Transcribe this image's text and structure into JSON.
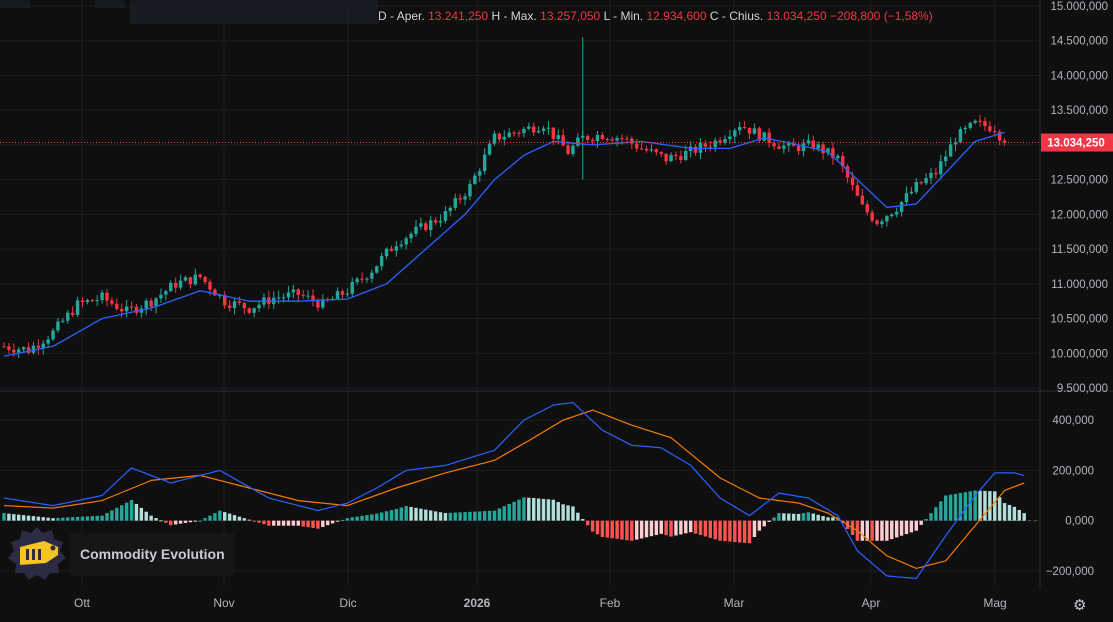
{
  "ohlc_header": {
    "prefix": "D",
    "open_label": "Aper.",
    "open_value": "13.241,250",
    "high_label": "H - Max.",
    "high_value": "13.257,050",
    "low_label": "L - Min.",
    "low_value": "12.934,600",
    "close_label": "C - Chius.",
    "close_value": "13.034,250",
    "change": "−208,800 (−1,58%)"
  },
  "brand": {
    "name": "Commodity Evolution"
  },
  "last_price_label": "13.034,250",
  "colors": {
    "up": "#26a69a",
    "down": "#f23645",
    "ma": "#2962ff",
    "macd": "#2962ff",
    "signal": "#f57c00",
    "hist_up_strong": "#26a69a",
    "hist_up_weak": "#b2dfdb",
    "hist_down_strong": "#ff5252",
    "hist_down_weak": "#ffcdd2",
    "background": "#0f0f0f"
  },
  "chart_data": [
    {
      "type": "candlestick",
      "x_labels": [
        "Ott",
        "Nov",
        "Dic",
        "2026",
        "Feb",
        "Mar",
        "Apr",
        "Mag"
      ],
      "y_ticks": [
        "15.000,000",
        "14.500,000",
        "14.000,000",
        "13.500,000",
        "13.000,000",
        "12.500,000",
        "12.000,000",
        "11.500,000",
        "11.000,000",
        "10.500,000",
        "10.000,000",
        "9.500,000"
      ],
      "ylim": [
        9500,
        15000
      ],
      "last_price": 13034.25,
      "close_path_keypoints": [
        [
          0,
          10100
        ],
        [
          5,
          10050
        ],
        [
          10,
          10300
        ],
        [
          15,
          10700
        ],
        [
          20,
          10800
        ],
        [
          25,
          10600
        ],
        [
          30,
          10750
        ],
        [
          35,
          11000
        ],
        [
          40,
          11100
        ],
        [
          45,
          10750
        ],
        [
          50,
          10650
        ],
        [
          55,
          10800
        ],
        [
          60,
          10850
        ],
        [
          65,
          10700
        ],
        [
          70,
          10900
        ],
        [
          75,
          11200
        ],
        [
          80,
          11600
        ],
        [
          85,
          11800
        ],
        [
          90,
          12000
        ],
        [
          95,
          12400
        ],
        [
          100,
          13100
        ],
        [
          105,
          13200
        ],
        [
          110,
          13300
        ],
        [
          115,
          12900
        ],
        [
          118,
          13100
        ],
        [
          122,
          13150
        ],
        [
          126,
          13100
        ],
        [
          130,
          12950
        ],
        [
          135,
          12800
        ],
        [
          140,
          12900
        ],
        [
          145,
          13050
        ],
        [
          150,
          13300
        ],
        [
          155,
          13100
        ],
        [
          160,
          12950
        ],
        [
          165,
          13000
        ],
        [
          170,
          12800
        ],
        [
          175,
          12100
        ],
        [
          178,
          11900
        ],
        [
          182,
          12100
        ],
        [
          186,
          12400
        ],
        [
          190,
          12600
        ],
        [
          194,
          13100
        ],
        [
          198,
          13300
        ],
        [
          202,
          13250
        ],
        [
          204,
          13034
        ]
      ],
      "ma_keypoints": [
        [
          0,
          9960
        ],
        [
          10,
          10100
        ],
        [
          20,
          10500
        ],
        [
          30,
          10650
        ],
        [
          40,
          10900
        ],
        [
          50,
          10750
        ],
        [
          60,
          10750
        ],
        [
          70,
          10780
        ],
        [
          78,
          11000
        ],
        [
          86,
          11500
        ],
        [
          94,
          12000
        ],
        [
          100,
          12500
        ],
        [
          106,
          12850
        ],
        [
          112,
          13050
        ],
        [
          120,
          13000
        ],
        [
          130,
          13050
        ],
        [
          140,
          12950
        ],
        [
          148,
          12950
        ],
        [
          155,
          13100
        ],
        [
          162,
          13000
        ],
        [
          168,
          12900
        ],
        [
          174,
          12500
        ],
        [
          180,
          12100
        ],
        [
          186,
          12150
        ],
        [
          192,
          12600
        ],
        [
          198,
          13050
        ],
        [
          204,
          13180
        ]
      ]
    },
    {
      "type": "macd",
      "y_ticks": [
        "400,000",
        "200,000",
        "0,000",
        "−200,000"
      ],
      "ylim": [
        -260,
        500
      ],
      "macd_keypoints": [
        [
          0,
          90
        ],
        [
          10,
          60
        ],
        [
          20,
          100
        ],
        [
          26,
          210
        ],
        [
          34,
          150
        ],
        [
          44,
          200
        ],
        [
          54,
          90
        ],
        [
          64,
          40
        ],
        [
          70,
          70
        ],
        [
          76,
          130
        ],
        [
          82,
          200
        ],
        [
          90,
          220
        ],
        [
          100,
          280
        ],
        [
          106,
          400
        ],
        [
          112,
          460
        ],
        [
          116,
          470
        ],
        [
          122,
          360
        ],
        [
          128,
          300
        ],
        [
          134,
          290
        ],
        [
          140,
          220
        ],
        [
          146,
          90
        ],
        [
          152,
          20
        ],
        [
          158,
          110
        ],
        [
          164,
          90
        ],
        [
          170,
          20
        ],
        [
          174,
          -120
        ],
        [
          180,
          -220
        ],
        [
          186,
          -230
        ],
        [
          192,
          -60
        ],
        [
          198,
          100
        ],
        [
          202,
          190
        ],
        [
          206,
          190
        ],
        [
          208,
          180
        ]
      ],
      "signal_keypoints": [
        [
          0,
          60
        ],
        [
          10,
          50
        ],
        [
          20,
          80
        ],
        [
          30,
          160
        ],
        [
          40,
          180
        ],
        [
          50,
          130
        ],
        [
          60,
          80
        ],
        [
          70,
          60
        ],
        [
          80,
          130
        ],
        [
          90,
          190
        ],
        [
          100,
          240
        ],
        [
          108,
          330
        ],
        [
          114,
          400
        ],
        [
          120,
          440
        ],
        [
          128,
          380
        ],
        [
          136,
          330
        ],
        [
          146,
          170
        ],
        [
          154,
          90
        ],
        [
          162,
          70
        ],
        [
          168,
          30
        ],
        [
          174,
          -40
        ],
        [
          180,
          -140
        ],
        [
          186,
          -190
        ],
        [
          192,
          -160
        ],
        [
          198,
          -20
        ],
        [
          204,
          120
        ],
        [
          208,
          150
        ]
      ]
    }
  ]
}
